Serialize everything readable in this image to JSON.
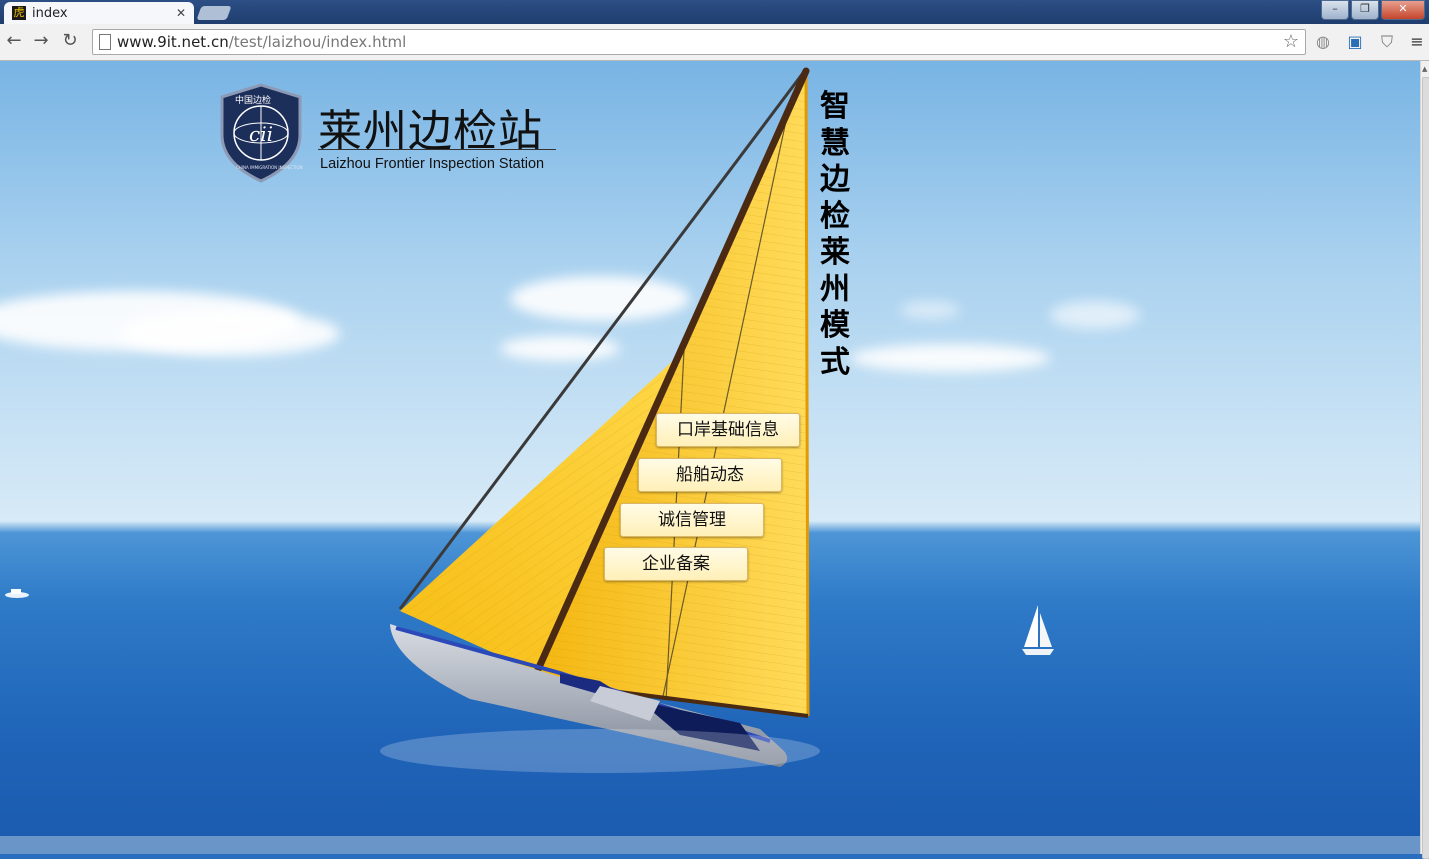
{
  "browser": {
    "tab_title": "index",
    "tab_favicon_char": "虎",
    "url_host": "www.9it.net.cn",
    "url_path": "/test/laizhou/index.html",
    "icons": {
      "back": "back-arrow-icon",
      "forward": "forward-arrow-icon",
      "reload": "reload-icon",
      "bookmark": "star-icon"
    }
  },
  "site": {
    "title": "莱州边检站",
    "subtitle": "Laizhou Frontier Inspection Station",
    "emblem_text_top": "中国边检",
    "emblem_text_ring": "CHINA IMMIGRATION INSPECTION",
    "slogan": [
      "智",
      "慧",
      "边",
      "检",
      "莱",
      "州",
      "模",
      "式"
    ],
    "menu": [
      {
        "label": "口岸基础信息"
      },
      {
        "label": "船舶动态"
      },
      {
        "label": "诚信管理"
      },
      {
        "label": "企业备案"
      }
    ]
  },
  "colors": {
    "sail": "#f7c21a",
    "sail_light": "#ffd94d",
    "sky": "#a9d1ef",
    "sea": "#1f64b8",
    "button_bg": "#fff3c4",
    "emblem": "#1c2e5a"
  }
}
